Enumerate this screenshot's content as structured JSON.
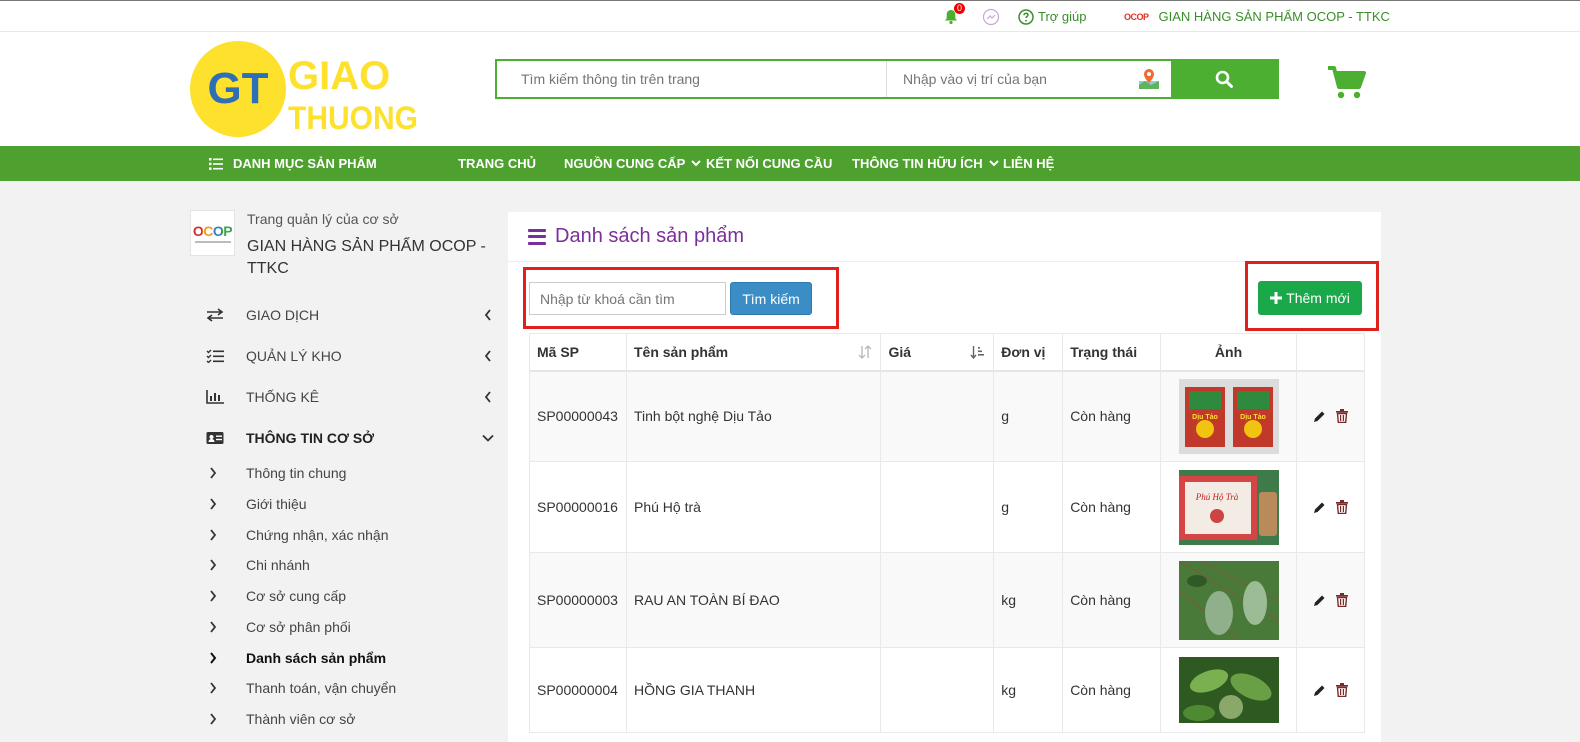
{
  "topbar": {
    "notification_count": "0",
    "help_label": "Trợ giúp",
    "shop_logo_text": "OCOP",
    "shop_name": "GIAN HÀNG SẢN PHẨM OCOP - TTKC"
  },
  "header": {
    "logo_initials": "GT",
    "logo_line1": "GIAO",
    "logo_line2": "THUONG",
    "search_placeholder": "Tìm kiếm thông tin trên trang",
    "location_placeholder": "Nhập vào vị trí của bạn"
  },
  "nav": {
    "category_label": "DANH MỤC SẢN PHẨM",
    "items": [
      "TRANG CHỦ",
      "NGUỒN CUNG CẤP",
      "KẾT NỐI CUNG CẦU",
      "THÔNG TIN HỮU ÍCH",
      "LIÊN HỆ"
    ]
  },
  "sidebar": {
    "logo_text": "OCOP",
    "subtitle": "Trang quản lý của cơ sở",
    "title": "GIAN HÀNG SẢN PHẨM OCOP - TTKC",
    "menu": [
      "GIAO DỊCH",
      "QUẢN LÝ KHO",
      "THỐNG KÊ",
      "THÔNG TIN CƠ SỞ"
    ],
    "submenu": [
      "Thông tin chung",
      "Giới thiệu",
      "Chứng nhận, xác nhận",
      "Chi nhánh",
      "Cơ sở cung cấp",
      "Cơ sở phân phối",
      "Danh sách sản phẩm",
      "Thanh toán, vận chuyển",
      "Thành viên cơ sở"
    ]
  },
  "content": {
    "title": "Danh sách sản phẩm",
    "keyword_placeholder": "Nhập từ khoá cần tìm",
    "search_button": "Tìm kiếm",
    "add_button": "Thêm mới",
    "columns": [
      "Mã SP",
      "Tên sản phẩm",
      "Giá",
      "Đơn vị",
      "Trạng thái",
      "Ảnh"
    ],
    "rows": [
      {
        "code": "SP00000043",
        "name": "Tinh bột nghệ Dịu Tảo",
        "price": "",
        "unit": "g",
        "status": "Còn hàng",
        "image_label": "Dịu Tảo"
      },
      {
        "code": "SP00000016",
        "name": "Phú Hộ trà",
        "price": "",
        "unit": "g",
        "status": "Còn hàng",
        "image_label": "Phú Hộ Trà"
      },
      {
        "code": "SP00000003",
        "name": "RAU AN TOÀN BÍ ĐAO",
        "price": "",
        "unit": "kg",
        "status": "Còn hàng",
        "image_label": ""
      },
      {
        "code": "SP00000004",
        "name": "HỒNG GIA THANH",
        "price": "",
        "unit": "kg",
        "status": "Còn hàng",
        "image_label": ""
      }
    ]
  },
  "colors": {
    "brand_green": "#4ea12f",
    "title_purple": "#7b2f9a",
    "search_blue": "#3b8dc5",
    "add_green": "#1aa84a",
    "highlight_red": "#e0201c"
  }
}
